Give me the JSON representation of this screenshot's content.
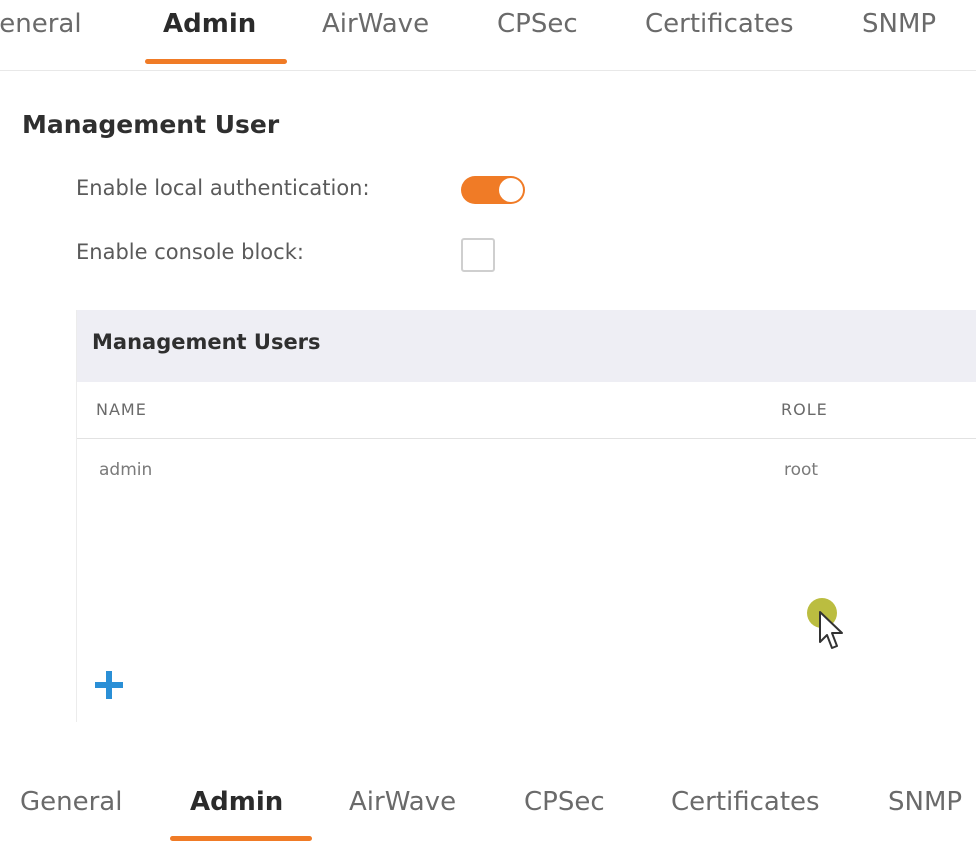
{
  "tabs_top": [
    {
      "label": "ieneral",
      "active": false
    },
    {
      "label": "Admin",
      "active": true
    },
    {
      "label": "AirWave",
      "active": false
    },
    {
      "label": "CPSec",
      "active": false
    },
    {
      "label": "Certificates",
      "active": false
    },
    {
      "label": "SNMP",
      "active": false
    }
  ],
  "tabs_bottom": [
    {
      "label": "General",
      "active": false
    },
    {
      "label": "Admin",
      "active": true
    },
    {
      "label": "AirWave",
      "active": false
    },
    {
      "label": "CPSec",
      "active": false
    },
    {
      "label": "Certificates",
      "active": false
    },
    {
      "label": "SNMP",
      "active": false
    }
  ],
  "section": {
    "title": "Management User",
    "fields": [
      {
        "label": "Enable local authentication:",
        "type": "toggle",
        "checked": true
      },
      {
        "label": "Enable console block:",
        "type": "checkbox",
        "checked": false
      }
    ]
  },
  "users_table": {
    "title": "Management Users",
    "columns": [
      "NAME",
      "ROLE"
    ],
    "rows": [
      [
        "admin",
        "root"
      ]
    ]
  },
  "colors": {
    "accent": "#f07b26",
    "add_icon": "#2a8fd6",
    "panel_header_bg": "#eeeef4"
  },
  "icons": {
    "add": "plus-icon",
    "cursor": "mouse-pointer-icon"
  }
}
